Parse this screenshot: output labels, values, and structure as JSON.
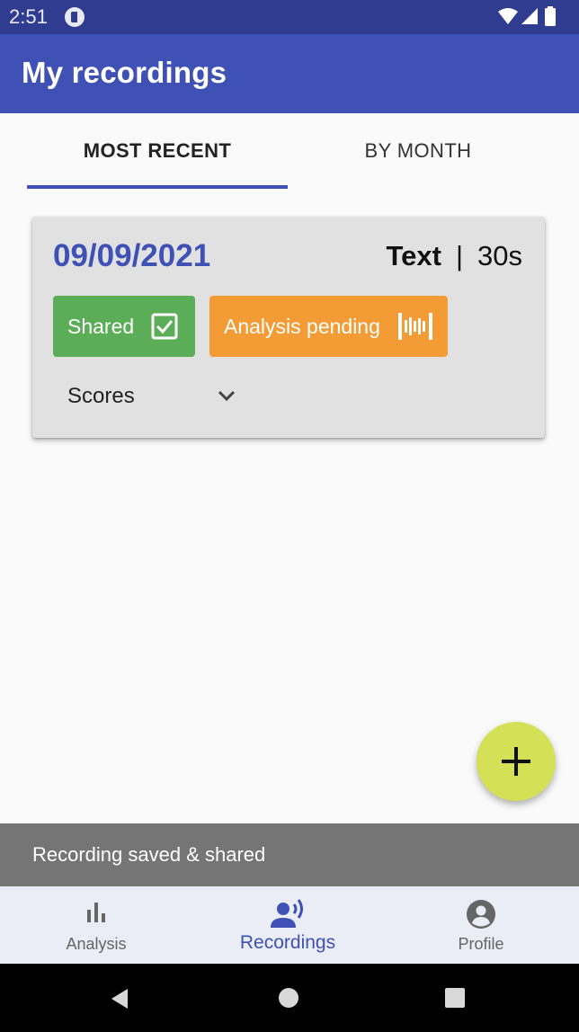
{
  "status_bar": {
    "time": "2:51",
    "app_icon": "podcast-app-icon",
    "icons": [
      "wifi-icon",
      "signal-icon",
      "battery-icon"
    ]
  },
  "app_bar": {
    "title": "My recordings"
  },
  "tabs": [
    {
      "label": "MOST RECENT",
      "selected": true
    },
    {
      "label": "BY MONTH",
      "selected": false
    }
  ],
  "recording": {
    "date": "09/09/2021",
    "type": "Text",
    "separator": "|",
    "duration": "30s",
    "badges": {
      "shared": {
        "label": "Shared",
        "icon": "checkbox-checked-icon",
        "color": "#5cad57"
      },
      "pending": {
        "label": "Analysis pending",
        "icon": "audio-waveform-icon",
        "color": "#f39b35"
      }
    },
    "scores": {
      "label": "Scores",
      "icon": "chevron-down-icon"
    }
  },
  "fab": {
    "icon": "plus-icon",
    "color": "#d4e157"
  },
  "snackbar": {
    "message": "Recording saved & shared"
  },
  "bottom_nav": {
    "items": [
      {
        "label": "Analysis",
        "icon": "bar-chart-icon",
        "selected": false
      },
      {
        "label": "Recordings",
        "icon": "record-voice-icon",
        "selected": true
      },
      {
        "label": "Profile",
        "icon": "account-circle-icon",
        "selected": false
      }
    ]
  },
  "colors": {
    "primary": "#3f51b5",
    "status_bar": "#303c90",
    "nav_background": "#eaecf6"
  }
}
